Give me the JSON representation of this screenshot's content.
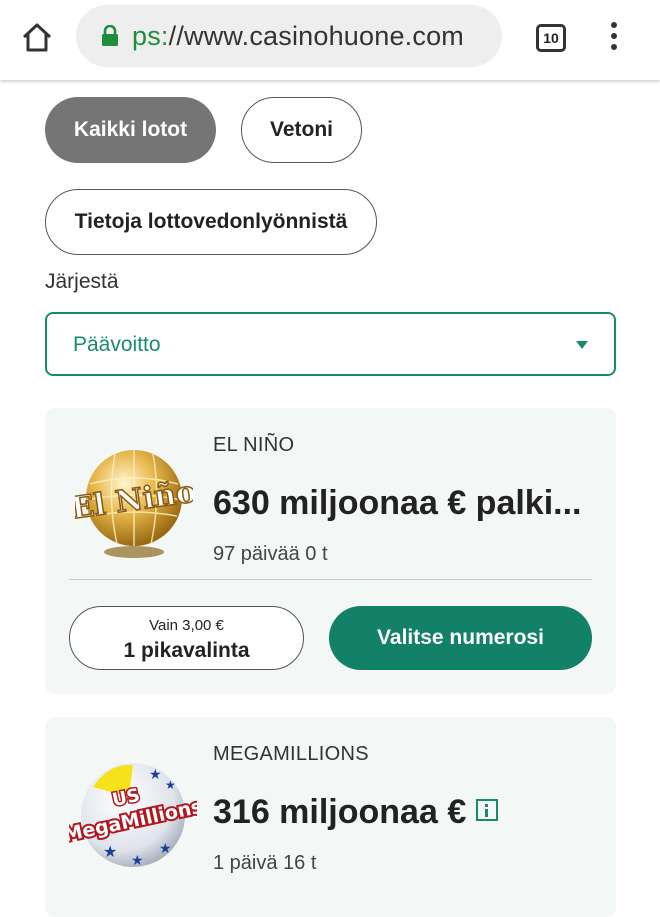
{
  "browser": {
    "url_scheme": "ps:",
    "url_host": "//www.casinohuone.com",
    "tab_count": "10",
    "icons": [
      "home-icon",
      "lock-icon",
      "tab-switcher-icon",
      "overflow-menu-icon"
    ]
  },
  "filters": {
    "all_lotteries": "Kaikki lotot",
    "bets": "Vetoni",
    "info": "Tietoja lottovedonlyönnistä"
  },
  "sort": {
    "label": "Järjestä",
    "selected": "Päävoitto"
  },
  "lotteries": [
    {
      "logo_text": "El Niño",
      "name": "EL NIÑO",
      "prize": "630 miljoonaa € palki...",
      "time_left": "97 päivää 0 t",
      "price_text": "Vain 3,00 €",
      "quickpick_label": "1 pikavalinta",
      "choose_label": "Valitse numerosi"
    },
    {
      "logo_text_1": "US",
      "logo_text_2": "MegaMillions",
      "name": "MEGAMILLIONS",
      "prize": "316 miljoonaa €",
      "time_left": "1 päivä 16 t"
    }
  ],
  "colors": {
    "accent": "#1a8a6e",
    "button_green": "#138068",
    "active_chip": "#757575",
    "card_bg": "#f3f7f6"
  }
}
